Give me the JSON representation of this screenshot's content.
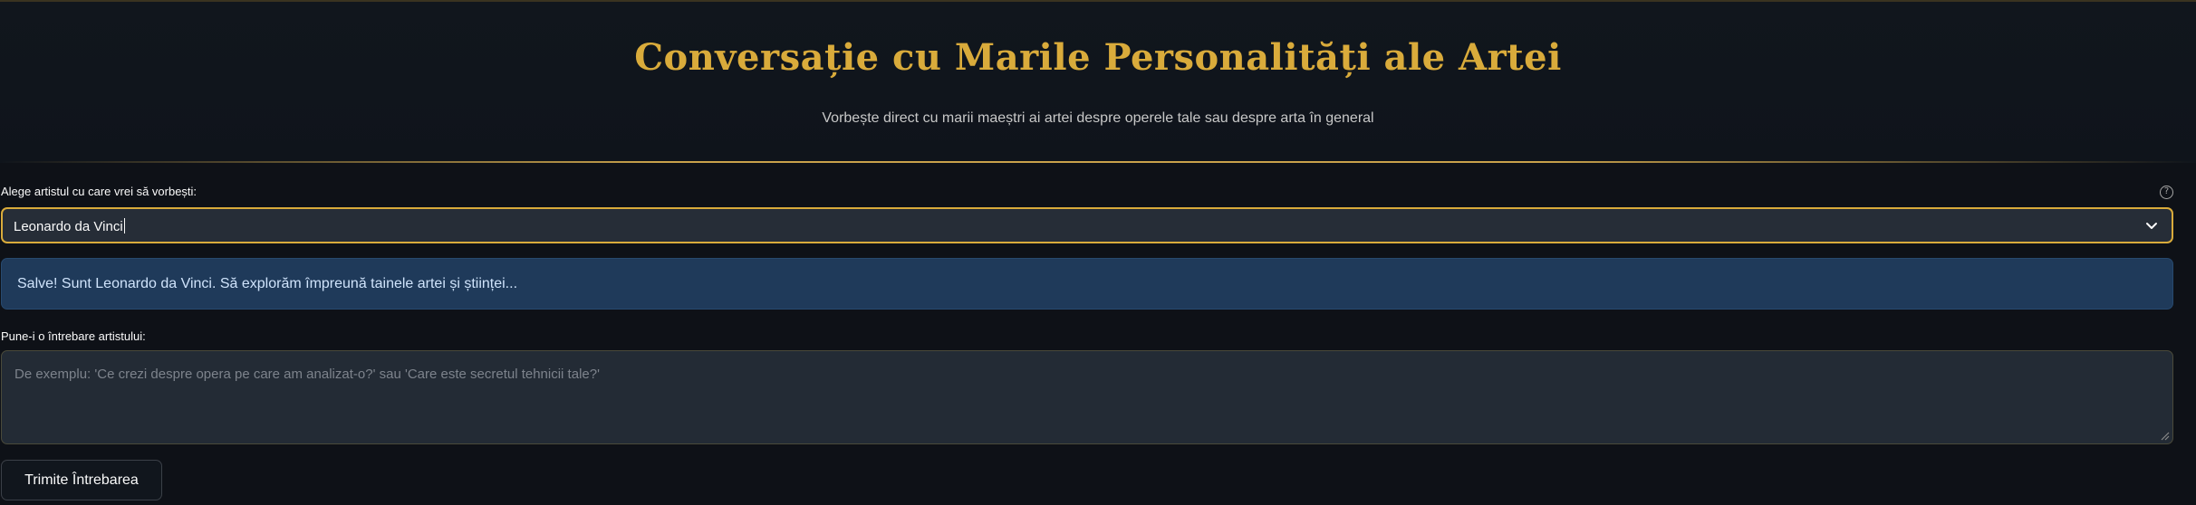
{
  "header": {
    "title": "Conversație cu Marile Personalități ale Artei",
    "subtitle": "Vorbește direct cu marii maeștri ai artei despre operele tale sau despre arta în general"
  },
  "artist_select": {
    "label": "Alege artistul cu care vrei să vorbești:",
    "value": "Leonardo da Vinci",
    "help_icon": "question-circle-icon",
    "dropdown_icon": "chevron-down-icon"
  },
  "greeting": {
    "text": "Salve! Sunt Leonardo da Vinci. Să explorăm împreună tainele artei și științei..."
  },
  "question": {
    "label": "Pune-i o întrebare artistului:",
    "placeholder": "De exemplu: 'Ce crezi despre opera pe care am analizat-o?' sau 'Care este secretul tehnicii tale?'"
  },
  "submit": {
    "label": "Trimite Întrebarea"
  },
  "colors": {
    "background": "#0e1117",
    "gold_accent": "#d9ab3b",
    "info_background": "#1f3a5a",
    "input_background": "#262d37"
  }
}
